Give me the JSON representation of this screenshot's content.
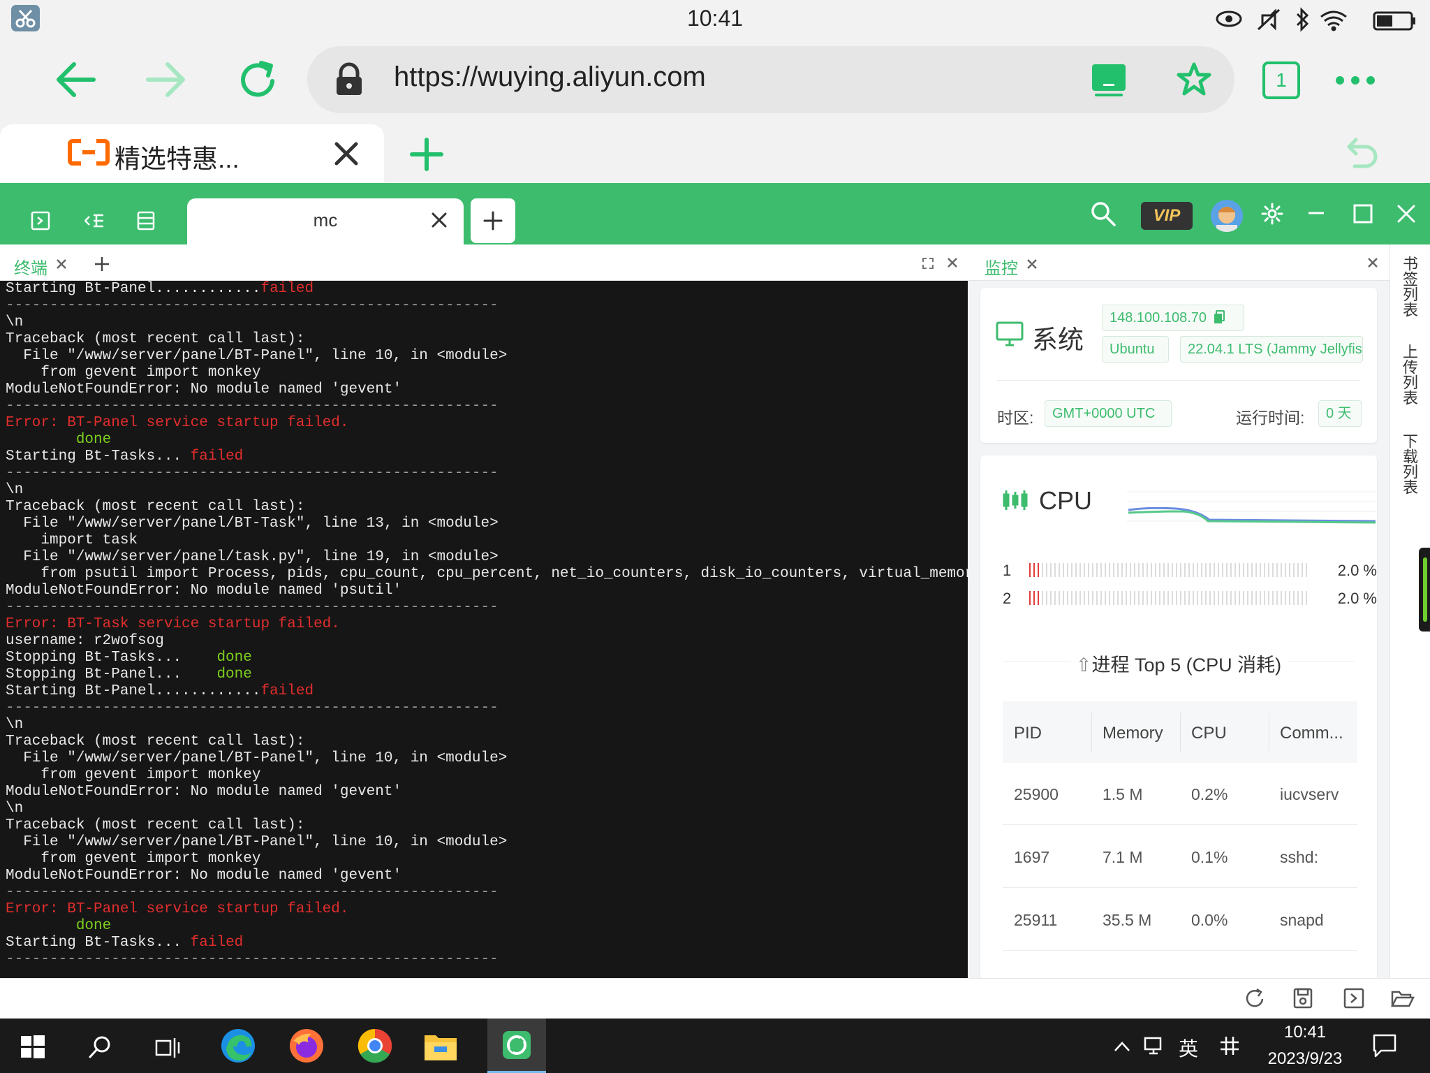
{
  "status_bar": {
    "time": "10:41"
  },
  "browser": {
    "url": "https://wuying.aliyun.com",
    "tab_count": "1",
    "tab_title": "精选特惠..."
  },
  "app": {
    "session_tab": "mc",
    "vip_label": "VIP",
    "accent_color": "#3dbc6e"
  },
  "panes": {
    "terminal_label": "终端",
    "monitor_label": "监控"
  },
  "terminal": {
    "lines": [
      [
        {
          "t": "Starting Bt-Panel............"
        },
        {
          "t": "failed",
          "c": "red"
        }
      ],
      [
        {
          "t": "--------------------------------------------------------",
          "c": "gray"
        }
      ],
      [
        {
          "t": "\\n"
        }
      ],
      [
        {
          "t": "Traceback (most recent call last):"
        }
      ],
      [
        {
          "t": "  File \"/www/server/panel/BT-Panel\", line 10, in <module>"
        }
      ],
      [
        {
          "t": "    from gevent import monkey"
        }
      ],
      [
        {
          "t": "ModuleNotFoundError: No module named 'gevent'"
        }
      ],
      [
        {
          "t": "--------------------------------------------------------",
          "c": "gray"
        }
      ],
      [
        {
          "t": "Error: BT-Panel service startup failed.",
          "c": "red"
        }
      ],
      [
        {
          "t": "        "
        },
        {
          "t": "done",
          "c": "green"
        }
      ],
      [
        {
          "t": "Starting Bt-Tasks... "
        },
        {
          "t": "failed",
          "c": "red"
        }
      ],
      [
        {
          "t": "--------------------------------------------------------",
          "c": "gray"
        }
      ],
      [
        {
          "t": "\\n"
        }
      ],
      [
        {
          "t": "Traceback (most recent call last):"
        }
      ],
      [
        {
          "t": "  File \"/www/server/panel/BT-Task\", line 13, in <module>"
        }
      ],
      [
        {
          "t": "    import task"
        }
      ],
      [
        {
          "t": "  File \"/www/server/panel/task.py\", line 19, in <module>"
        }
      ],
      [
        {
          "t": "    from psutil import Process, pids, cpu_count, cpu_percent, net_io_counters, disk_io_counters, virtual_memory"
        }
      ],
      [
        {
          "t": "ModuleNotFoundError: No module named 'psutil'"
        }
      ],
      [
        {
          "t": "--------------------------------------------------------",
          "c": "gray"
        }
      ],
      [
        {
          "t": "Error: BT-Task service startup failed.",
          "c": "red"
        }
      ],
      [
        {
          "t": "username: r2wofsog"
        }
      ],
      [
        {
          "t": "Stopping Bt-Tasks...    "
        },
        {
          "t": "done",
          "c": "green"
        }
      ],
      [
        {
          "t": "Stopping Bt-Panel...    "
        },
        {
          "t": "done",
          "c": "green"
        }
      ],
      [
        {
          "t": "Starting Bt-Panel............"
        },
        {
          "t": "failed",
          "c": "red"
        }
      ],
      [
        {
          "t": "--------------------------------------------------------",
          "c": "gray"
        }
      ],
      [
        {
          "t": "\\n"
        }
      ],
      [
        {
          "t": "Traceback (most recent call last):"
        }
      ],
      [
        {
          "t": "  File \"/www/server/panel/BT-Panel\", line 10, in <module>"
        }
      ],
      [
        {
          "t": "    from gevent import monkey"
        }
      ],
      [
        {
          "t": "ModuleNotFoundError: No module named 'gevent'"
        }
      ],
      [
        {
          "t": "\\n"
        }
      ],
      [
        {
          "t": "Traceback (most recent call last):"
        }
      ],
      [
        {
          "t": "  File \"/www/server/panel/BT-Panel\", line 10, in <module>"
        }
      ],
      [
        {
          "t": "    from gevent import monkey"
        }
      ],
      [
        {
          "t": "ModuleNotFoundError: No module named 'gevent'"
        }
      ],
      [
        {
          "t": "--------------------------------------------------------",
          "c": "gray"
        }
      ],
      [
        {
          "t": "Error: BT-Panel service startup failed.",
          "c": "red"
        }
      ],
      [
        {
          "t": "        "
        },
        {
          "t": "done",
          "c": "green"
        }
      ],
      [
        {
          "t": "Starting Bt-Tasks... "
        },
        {
          "t": "failed",
          "c": "red"
        }
      ],
      [
        {
          "t": "--------------------------------------------------------",
          "c": "gray"
        }
      ]
    ]
  },
  "monitor": {
    "system": {
      "title": "系统",
      "ip": "148.100.108.70",
      "os": "Ubuntu",
      "version": "22.04.1 LTS (Jammy Jellyfish)",
      "timezone_label": "时区:",
      "timezone": "GMT+0000   UTC",
      "uptime_label": "运行时间:",
      "uptime": "0 天"
    },
    "cpu": {
      "title": "CPU",
      "cores": [
        {
          "id": "1",
          "percent": 2.0,
          "label": "2.0 %"
        },
        {
          "id": "2",
          "percent": 2.0,
          "label": "2.0 %"
        }
      ]
    },
    "processes": {
      "title": "进程 Top 5 (CPU 消耗)",
      "columns": [
        "PID",
        "Memory",
        "CPU",
        "Comm..."
      ],
      "rows": [
        [
          "25900",
          "1.5 M",
          "0.2%",
          "iucvserv"
        ],
        [
          "1697",
          "7.1 M",
          "0.1%",
          "sshd:"
        ],
        [
          "25911",
          "35.5 M",
          "0.0%",
          "snapd"
        ]
      ]
    }
  },
  "side_panel": [
    "书签列表",
    "上传列表",
    "下载列表"
  ],
  "taskbar": {
    "ime": "英",
    "time": "10:41",
    "date": "2023/9/23"
  }
}
